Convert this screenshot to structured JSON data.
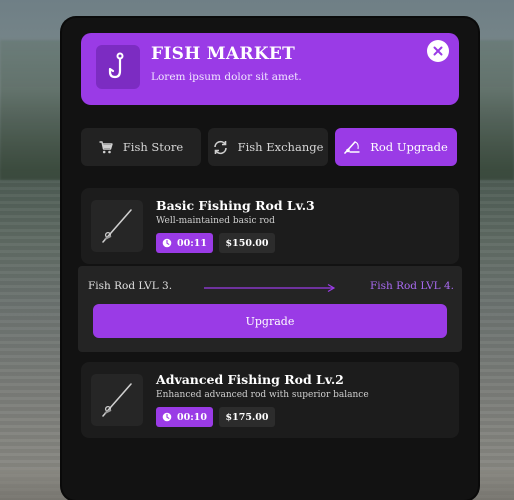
{
  "header": {
    "title": "FISH MARKET",
    "subtitle": "Lorem ipsum dolor sit amet.",
    "icon": "fishing-hook-icon",
    "close_icon": "close-icon"
  },
  "tabs": [
    {
      "label": "Fish Store",
      "icon": "cart-icon",
      "active": false
    },
    {
      "label": "Fish Exchange",
      "icon": "exchange-icon",
      "active": false
    },
    {
      "label": "Rod Upgrade",
      "icon": "fishing-rod-icon",
      "active": true
    }
  ],
  "rods": [
    {
      "name": "Basic Fishing Rod Lv.3",
      "description": "Well-maintained basic rod",
      "time": "00:11",
      "price": "$150.00",
      "icon": "fishing-rod-icon"
    },
    {
      "name": "Advanced Fishing Rod Lv.2",
      "description": "Enhanced advanced rod with superior balance",
      "time": "00:10",
      "price": "$175.00",
      "icon": "fishing-rod-icon"
    }
  ],
  "upgrade": {
    "from_level": "Fish Rod LVL 3.",
    "to_level": "Fish Rod LVL 4.",
    "button_label": "Upgrade"
  },
  "colors": {
    "accent": "#9a3be6",
    "panel": "#121212",
    "card": "#1c1c1c"
  }
}
